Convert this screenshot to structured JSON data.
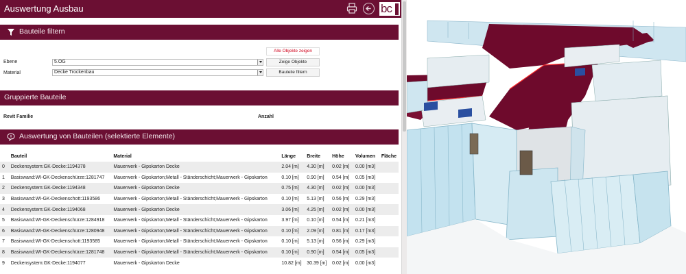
{
  "app": {
    "title": "Auswertung Ausbau",
    "logo_text": "bc",
    "brand_color": "#6b0f33"
  },
  "filter_section": {
    "title": "Bauteile filtern",
    "icon": "funnel-icon",
    "show_all_button": "Alle Objekte zeigen",
    "level_label": "Ebene",
    "level_value": "5.OG",
    "show_objects_button": "Zeige Objekte",
    "material_label": "Material",
    "material_value": "Decke Trockenbau",
    "filter_button": "Bauteile filtern"
  },
  "grouped_section": {
    "title": "Gruppierte Bauteile",
    "col_family": "Revit Familie",
    "col_count": "Anzahl"
  },
  "evaluation_section": {
    "title": "Auswertung von Bauteilen (selektierte Elemente)",
    "icon": "speech-bubble-icon",
    "columns": [
      "",
      "Bauteil",
      "Material",
      "Länge",
      "Breite",
      "Höhe",
      "Volumen",
      "Fläche"
    ],
    "rows": [
      [
        "0",
        "Deckensystem:GK-Decke:1194378",
        "Mauerwerk - Gipskarton Decke",
        "2.04 [m]",
        "4.30 [m]",
        "0.02 [m]",
        "0.00 [m3]",
        ""
      ],
      [
        "1",
        "Basiswand:WI-GK-Deckenschürze:1281747",
        "Mauerwerk - Gipskarton;Metall - Ständerschicht;Mauerwerk - Gipskarton",
        "0.10 [m]",
        "0.90 [m]",
        "0.54 [m]",
        "0.05 [m3]",
        ""
      ],
      [
        "2",
        "Deckensystem:GK-Decke:1194348",
        "Mauerwerk - Gipskarton Decke",
        "0.75 [m]",
        "4.30 [m]",
        "0.02 [m]",
        "0.00 [m3]",
        ""
      ],
      [
        "3",
        "Basiswand:WI-GK-Deckenschott:1193586",
        "Mauerwerk - Gipskarton;Metall - Ständerschicht;Mauerwerk - Gipskarton",
        "0.10 [m]",
        "5.13 [m]",
        "0.56 [m]",
        "0.29 [m3]",
        ""
      ],
      [
        "4",
        "Deckensystem:GK-Decke:1194068",
        "Mauerwerk - Gipskarton Decke",
        "3.06 [m]",
        "4.25 [m]",
        "0.02 [m]",
        "0.00 [m3]",
        ""
      ],
      [
        "5",
        "Basiswand:WI-GK-Deckenschürze:1284918",
        "Mauerwerk - Gipskarton;Metall - Ständerschicht;Mauerwerk - Gipskarton",
        "3.97 [m]",
        "0.10 [m]",
        "0.54 [m]",
        "0.21 [m3]",
        ""
      ],
      [
        "6",
        "Basiswand:WI-GK-Deckenschürze:1280948",
        "Mauerwerk - Gipskarton;Metall - Ständerschicht;Mauerwerk - Gipskarton",
        "0.10 [m]",
        "2.09 [m]",
        "0.81 [m]",
        "0.17 [m3]",
        ""
      ],
      [
        "7",
        "Basiswand:WI-GK-Deckenschott:1193585",
        "Mauerwerk - Gipskarton;Metall - Ständerschicht;Mauerwerk - Gipskarton",
        "0.10 [m]",
        "5.13 [m]",
        "0.56 [m]",
        "0.29 [m3]",
        ""
      ],
      [
        "8",
        "Basiswand:WI-GK-Deckenschürze:1281748",
        "Mauerwerk - Gipskarton;Metall - Ständerschicht;Mauerwerk - Gipskarton",
        "0.10 [m]",
        "0.90 [m]",
        "0.54 [m]",
        "0.05 [m3]",
        ""
      ],
      [
        "9",
        "Deckensystem:GK-Decke:1194077",
        "Mauerwerk - Gipskarton Decke",
        "10.82 [m]",
        "30.39 [m]",
        "0.02 [m]",
        "0.00 [m3]",
        ""
      ]
    ]
  },
  "viewer": {
    "ceiling_color": "#6e0a2c",
    "glass_color": "#bfe0ee",
    "wall_color": "#e9eef2"
  }
}
